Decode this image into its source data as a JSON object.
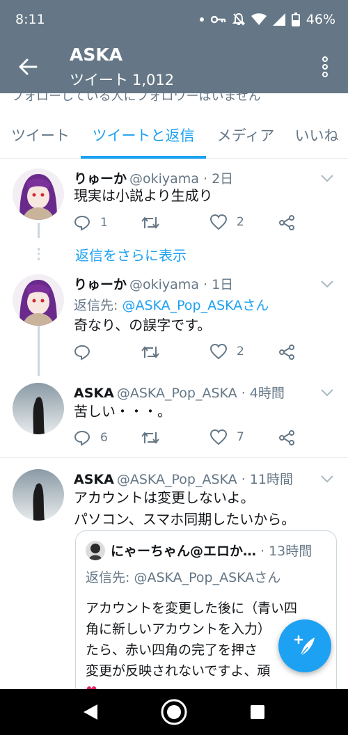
{
  "status_bar": {
    "time": "8:11",
    "battery": "46%"
  },
  "app_bar": {
    "title": "ASKA",
    "subtitle_label": "ツイート",
    "subtitle_count": "1,012"
  },
  "follow_note": "フォローしている人にフォロワーはいません",
  "tabs": [
    {
      "label": "ツイート"
    },
    {
      "label": "ツイートと返信",
      "active": true
    },
    {
      "label": "メディア"
    },
    {
      "label": "いいね"
    }
  ],
  "tweets": [
    {
      "name": "りゅーか",
      "handle": "@okiyama · 2日",
      "text": "現実は小説より生成り",
      "reply_count": "1",
      "retweet_count": "",
      "like_count": "2"
    },
    {
      "name": "りゅーか",
      "handle": "@okiyama · 1日",
      "reply_label": "返信先:",
      "reply_mention": "@ASKA_Pop_ASKAさん",
      "text": "奇なり、の誤字です。",
      "reply_count": "",
      "retweet_count": "",
      "like_count": "2"
    },
    {
      "name": "ASKA",
      "handle": "@ASKA_Pop_ASKA · 4時間",
      "text": "苦しい・・・。",
      "reply_count": "6",
      "retweet_count": "",
      "like_count": "7"
    },
    {
      "name": "ASKA",
      "handle": "@ASKA_Pop_ASKA · 11時間",
      "text_line1": "アカウントは変更しないよ。",
      "text_line2": "パソコン、スマホ同期したいから。"
    }
  ],
  "show_more_replies": "返信をさらに表示",
  "quote": {
    "name": "にゃーちゃん@エロか…",
    "time": "· 13時間",
    "reply_to": "返信先: @ASKA_Pop_ASKAさん",
    "line1": "アカウントを変更した後に（青い四",
    "line2": "角に新しいアカウントを入力）",
    "line3": "たら、赤い四角の完了を押さ",
    "line4": "変更が反映されないですよ、頑",
    "line5": "♥"
  },
  "colors": {
    "header": "#657786",
    "accent": "#1da1f2",
    "text": "#14171a",
    "muted": "#657786"
  }
}
